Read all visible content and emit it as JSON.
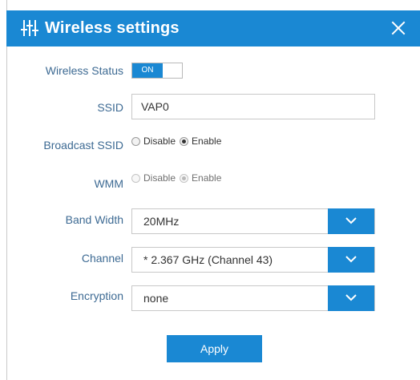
{
  "dialog": {
    "title": "Wireless settings",
    "title_icon": "sliders-icon",
    "close_icon": "close-icon",
    "accent_color": "#1a88d3"
  },
  "form": {
    "wireless_status": {
      "label": "Wireless Status",
      "toggle_text": "ON",
      "state": "on"
    },
    "ssid": {
      "label": "SSID",
      "value": "VAP0"
    },
    "broadcast_ssid": {
      "label": "Broadcast SSID",
      "options": [
        "Disable",
        "Enable"
      ],
      "selected": "Enable"
    },
    "wmm": {
      "label": "WMM",
      "options": [
        "Disable",
        "Enable"
      ],
      "selected": "Enable",
      "disabled": true
    },
    "band_width": {
      "label": "Band Width",
      "value": "20MHz"
    },
    "channel": {
      "label": "Channel",
      "value": "* 2.367 GHz (Channel 43)"
    },
    "encryption": {
      "label": "Encryption",
      "value": "none"
    }
  },
  "actions": {
    "apply_label": "Apply"
  }
}
